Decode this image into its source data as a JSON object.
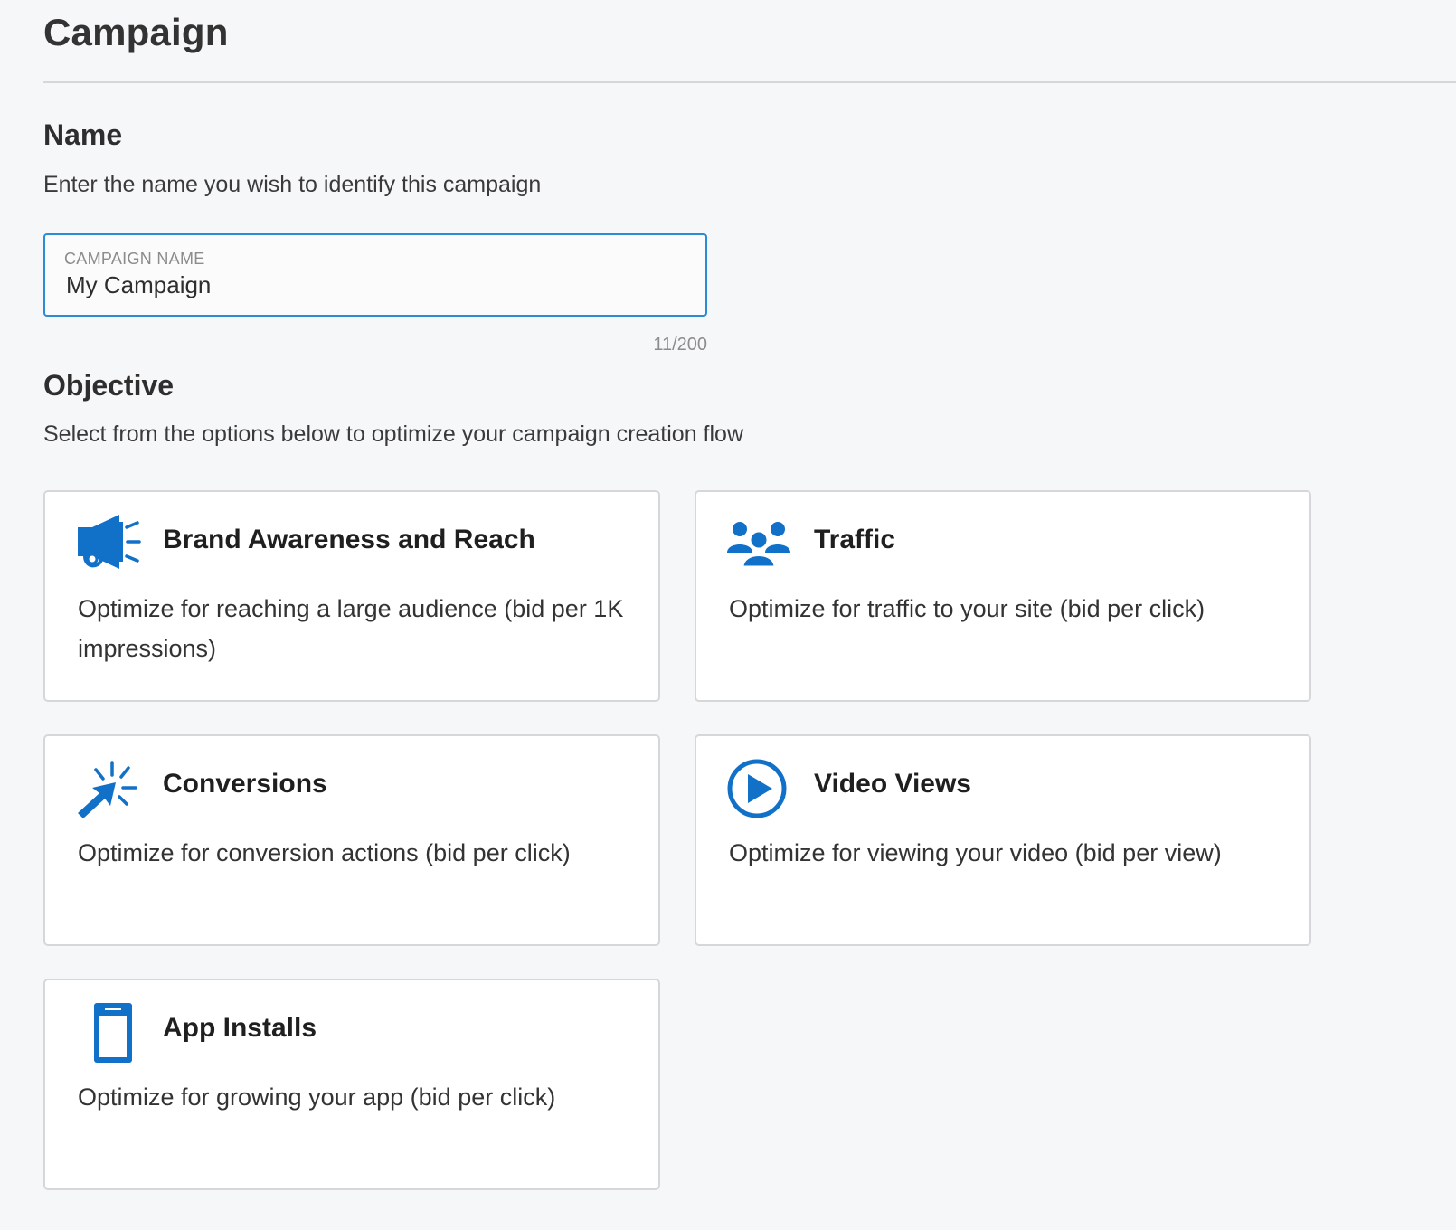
{
  "header": {
    "title": "Campaign"
  },
  "name_section": {
    "heading": "Name",
    "description": "Enter the name you wish to identify this campaign",
    "field": {
      "label": "CAMPAIGN NAME",
      "value": "My Campaign",
      "counter": "11/200"
    }
  },
  "objective_section": {
    "heading": "Objective",
    "description": "Select from the options below to optimize your campaign creation flow",
    "options": [
      {
        "title": "Brand Awareness and Reach",
        "description": "Optimize for reaching a large audience (bid per 1K impressions)",
        "icon": "megaphone-icon"
      },
      {
        "title": "Traffic",
        "description": "Optimize for traffic to your site (bid per click)",
        "icon": "people-group-icon"
      },
      {
        "title": "Conversions",
        "description": "Optimize for conversion actions (bid per click)",
        "icon": "cursor-click-icon"
      },
      {
        "title": "Video Views",
        "description": "Optimize for viewing your video (bid per view)",
        "icon": "play-circle-icon"
      },
      {
        "title": "App Installs",
        "description": "Optimize for growing your app (bid per click)",
        "icon": "mobile-phone-icon"
      }
    ]
  },
  "colors": {
    "accent": "#1170c8",
    "field_border": "#2a8bd6",
    "card_border": "#d5d7da",
    "background": "#f6f7f9"
  }
}
